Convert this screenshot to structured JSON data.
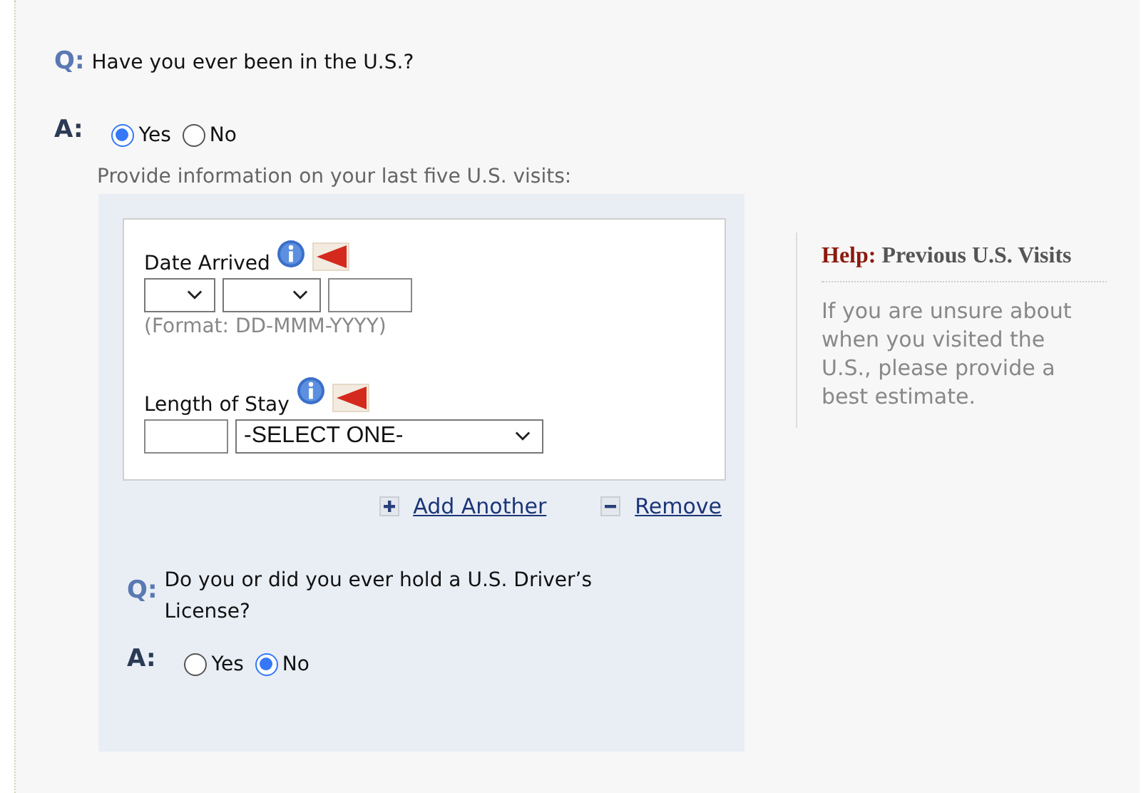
{
  "question1": {
    "q_mark": "Q:",
    "text": "Have you ever been in the U.S.?",
    "a_mark": "A:",
    "options": [
      {
        "label": "Yes",
        "selected": true
      },
      {
        "label": "No",
        "selected": false
      }
    ]
  },
  "visits_intro": "Provide information on your last five U.S. visits:",
  "visit": {
    "date_label": "Date Arrived",
    "date_format": "(Format: DD-MMM-YYYY)",
    "stay_label": "Length of Stay",
    "stay_unit": "-SELECT ONE-"
  },
  "actions": [
    {
      "kind": "add",
      "label": "Add Another"
    },
    {
      "kind": "remove",
      "label": "Remove"
    }
  ],
  "question2": {
    "q_mark": "Q:",
    "text": "Do you or did you ever hold a U.S. Driver’s License?",
    "a_mark": "A:",
    "options": [
      {
        "label": "Yes",
        "selected": false
      },
      {
        "label": "No",
        "selected": true
      }
    ]
  },
  "help": {
    "label": "Help:",
    "title": "Previous U.S. Visits",
    "text": "If you are unsure about when you visited the U.S., please provide a best estimate."
  }
}
